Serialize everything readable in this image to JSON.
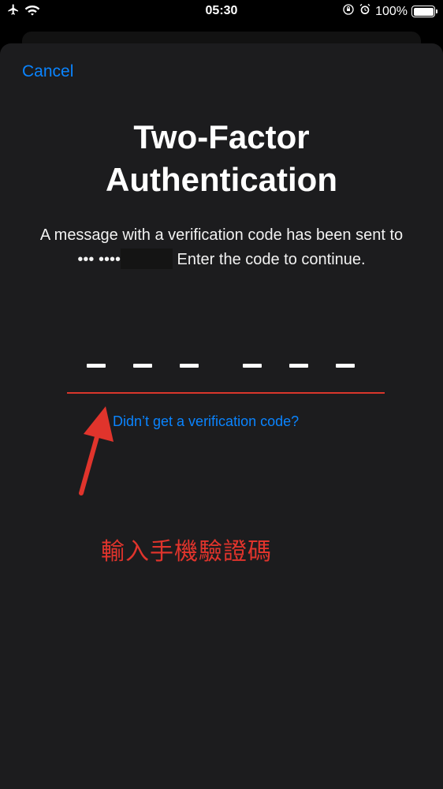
{
  "status_bar": {
    "time": "05:30",
    "battery_percent": "100%",
    "battery_level": 1.0,
    "icons": [
      "airplane-icon",
      "wifi-icon",
      "orientation-lock-icon",
      "alarm-icon",
      "battery-icon"
    ]
  },
  "dialog": {
    "cancel_label": "Cancel",
    "title_line1": "Two-Factor",
    "title_line2": "Authentication",
    "message_part1": "A message with a verification code has been sent to ••• ••••",
    "message_part2": " Enter the code to continue.",
    "code_length": 6,
    "resend_label": "Didn’t get a verification code?"
  },
  "annotation": {
    "text": "輸入手機驗證碼",
    "color": "#e0342c"
  },
  "colors": {
    "accent": "#0a84ff",
    "error_underline": "#d9362b",
    "sheet": "#1c1c1e"
  }
}
